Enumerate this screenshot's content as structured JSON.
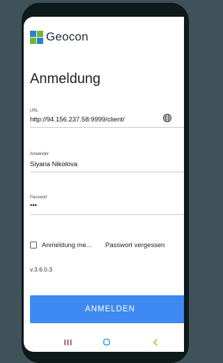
{
  "app": {
    "brand_name": "Geocon",
    "page_title": "Anmeldung"
  },
  "form": {
    "url": {
      "label": "URL",
      "value": "http://94.156.237.58:9999/client/"
    },
    "user": {
      "label": "Anwender",
      "value": "Siyana Nikolova"
    },
    "password": {
      "label": "Passwort",
      "value": "•••"
    },
    "remember_label": "Anmeldung me...",
    "remember_checked": false,
    "forgot_label": "Passwort vergessen"
  },
  "version": "v.3.6.0.3",
  "login_button_label": "ANMELDEN",
  "colors": {
    "accent": "#3f89f2",
    "logo_blue": "#2f7fd1",
    "logo_green": "#72b633",
    "backdrop": "#3f5159"
  },
  "nav": {
    "recent_icon": "recent-apps-icon",
    "home_icon": "home-icon",
    "back_icon": "back-icon"
  }
}
